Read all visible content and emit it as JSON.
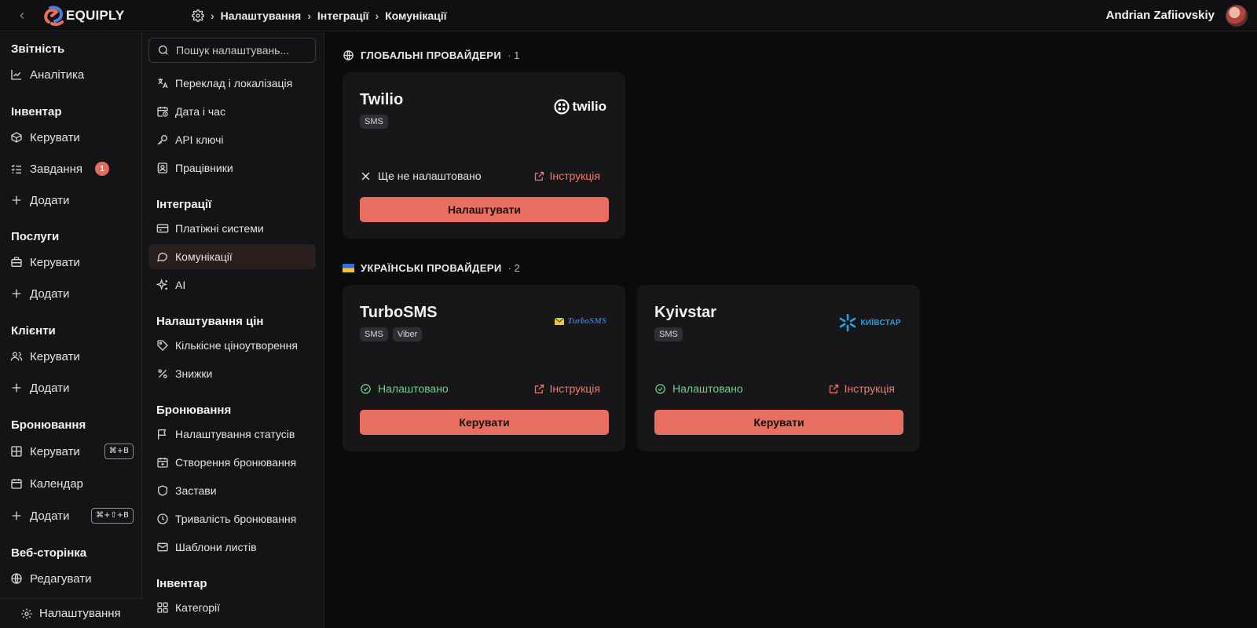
{
  "app": {
    "logo_text": "EQUIPLY"
  },
  "breadcrumb": [
    "Налаштування",
    "Інтеграції",
    "Комунікації"
  ],
  "user": {
    "name": "Andrian Zafiiovskiy"
  },
  "sidebar": {
    "sections": [
      {
        "title": "Звітність",
        "items": [
          {
            "label": "Аналітика",
            "icon": "chart-line-icon"
          }
        ]
      },
      {
        "title": "Інвентар",
        "items": [
          {
            "label": "Керувати",
            "icon": "box-icon"
          },
          {
            "label": "Завдання",
            "icon": "checklist-icon",
            "badge": "1"
          },
          {
            "label": "Додати",
            "icon": "plus-icon"
          }
        ]
      },
      {
        "title": "Послуги",
        "items": [
          {
            "label": "Керувати",
            "icon": "briefcase-icon"
          },
          {
            "label": "Додати",
            "icon": "plus-icon"
          }
        ]
      },
      {
        "title": "Клієнти",
        "items": [
          {
            "label": "Керувати",
            "icon": "users-icon"
          },
          {
            "label": "Додати",
            "icon": "plus-icon"
          }
        ]
      },
      {
        "title": "Бронювання",
        "items": [
          {
            "label": "Керувати",
            "icon": "grid-icon",
            "shortcut": "⌘+B"
          },
          {
            "label": "Календар",
            "icon": "calendar-icon"
          },
          {
            "label": "Додати",
            "icon": "plus-icon",
            "shortcut": "⌘+⇧+B"
          }
        ]
      },
      {
        "title": "Веб-сторінка",
        "items": [
          {
            "label": "Редагувати",
            "icon": "globe-icon"
          }
        ]
      }
    ],
    "settings_label": "Налаштування"
  },
  "settings_nav": {
    "search_placeholder": "Пошук налаштувань...",
    "top_items": [
      {
        "label": "Переклад і локалізація",
        "icon": "translate-icon"
      },
      {
        "label": "Дата і час",
        "icon": "calendar-clock-icon"
      },
      {
        "label": "API ключі",
        "icon": "key-icon"
      },
      {
        "label": "Працівники",
        "icon": "contact-icon"
      }
    ],
    "groups": [
      {
        "title": "Інтеграції",
        "items": [
          {
            "label": "Платіжні системи",
            "icon": "credit-card-icon"
          },
          {
            "label": "Комунікації",
            "icon": "chat-icon",
            "active": true
          },
          {
            "label": "AI",
            "icon": "sparkle-icon"
          }
        ]
      },
      {
        "title": "Налаштування цін",
        "items": [
          {
            "label": "Кількісне ціноутворення",
            "icon": "tag-icon"
          },
          {
            "label": "Знижки",
            "icon": "percent-icon"
          }
        ]
      },
      {
        "title": "Бронювання",
        "items": [
          {
            "label": "Налаштування статусів",
            "icon": "flag-icon"
          },
          {
            "label": "Створення бронювання",
            "icon": "calendar-plus-icon"
          },
          {
            "label": "Застави",
            "icon": "shield-icon"
          },
          {
            "label": "Тривалість бронювання",
            "icon": "clock-icon"
          },
          {
            "label": "Шаблони листів",
            "icon": "mail-icon"
          }
        ]
      },
      {
        "title": "Інвентар",
        "items": [
          {
            "label": "Категорії",
            "icon": "categories-icon"
          }
        ]
      }
    ]
  },
  "main": {
    "global": {
      "title": "ГЛОБАЛЬНІ ПРОВАЙДЕРИ",
      "count": "· 1",
      "providers": [
        {
          "name": "Twilio",
          "tags": [
            "SMS"
          ],
          "logo_text": "twilio",
          "status": "Ще не налаштовано",
          "configured": false,
          "instruction": "Інструкція",
          "action": "Налаштувати"
        }
      ]
    },
    "ukrainian": {
      "title": "УКРАЇНСЬКІ ПРОВАЙДЕРИ",
      "count": "· 2",
      "providers": [
        {
          "name": "TurboSMS",
          "tags": [
            "SMS",
            "Viber"
          ],
          "logo_text": "TurboSMS",
          "status": "Налаштовано",
          "configured": true,
          "instruction": "Інструкція",
          "action": "Керувати"
        },
        {
          "name": "Kyivstar",
          "tags": [
            "SMS"
          ],
          "logo_text": "КИЇВСТАР",
          "status": "Налаштовано",
          "configured": true,
          "instruction": "Інструкція",
          "action": "Керувати"
        }
      ]
    }
  },
  "colors": {
    "accent": "#e86e62",
    "success": "#6fd28f",
    "link": "#ef7a6c",
    "card": "#17171a"
  }
}
